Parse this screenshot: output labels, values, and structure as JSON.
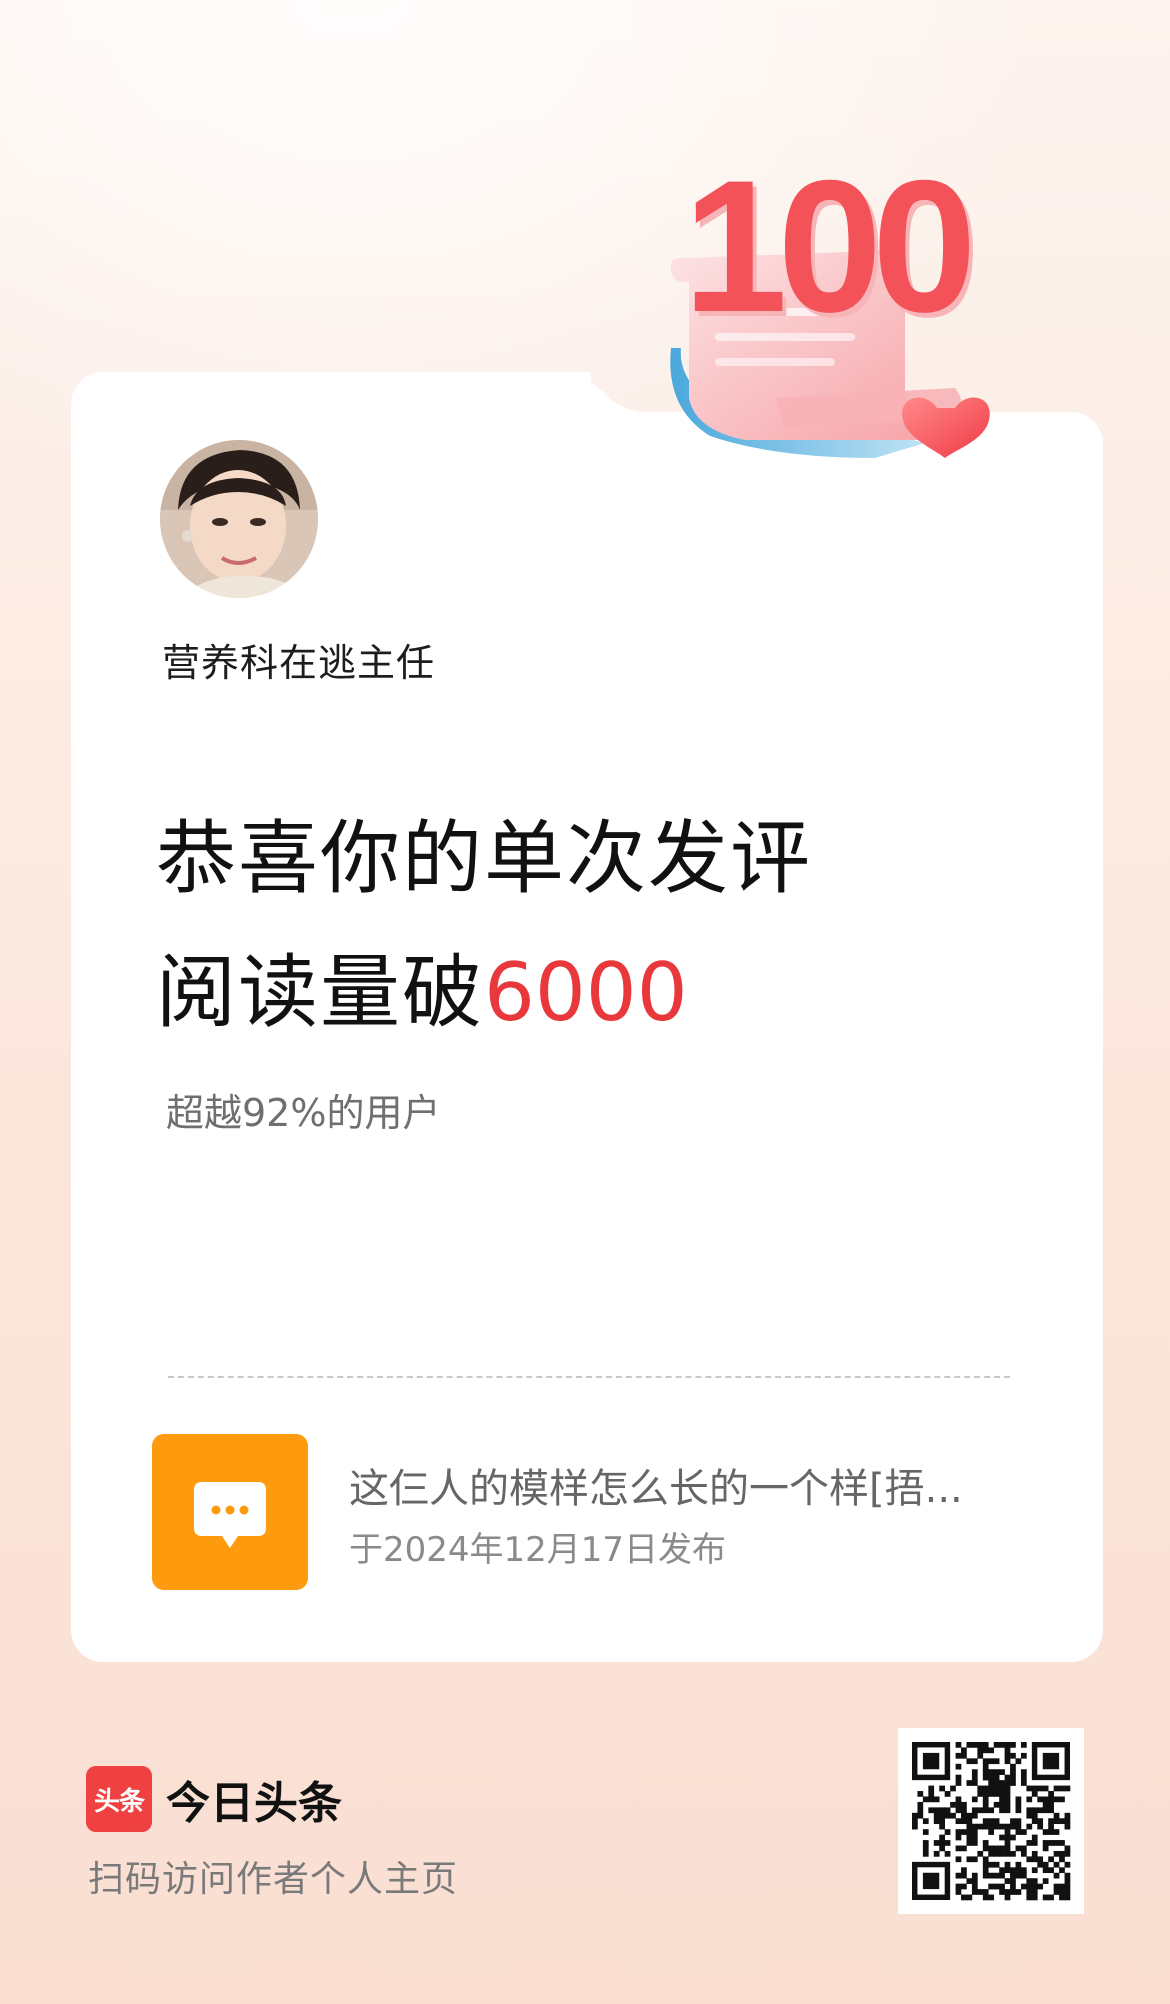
{
  "badge": {
    "number": "100"
  },
  "author": {
    "name": "营养科在逃主任"
  },
  "headline": {
    "line1": "恭喜你的单次发评",
    "line2_prefix": "阅读量破",
    "line2_number": "6000"
  },
  "percentile_text": "超越92%的用户",
  "post": {
    "title": "这仨人的模样怎么长的一个样[捂...",
    "date": "于2024年12月17日发布",
    "icon": "comment-bubble-icon"
  },
  "footer": {
    "logo_text": "头条",
    "brand_name": "今日头条",
    "scan_text": "扫码访问作者个人主页"
  },
  "colors": {
    "accent_red": "#e8383c",
    "icon_orange": "#fe9a0e",
    "logo_red": "#f04142"
  }
}
